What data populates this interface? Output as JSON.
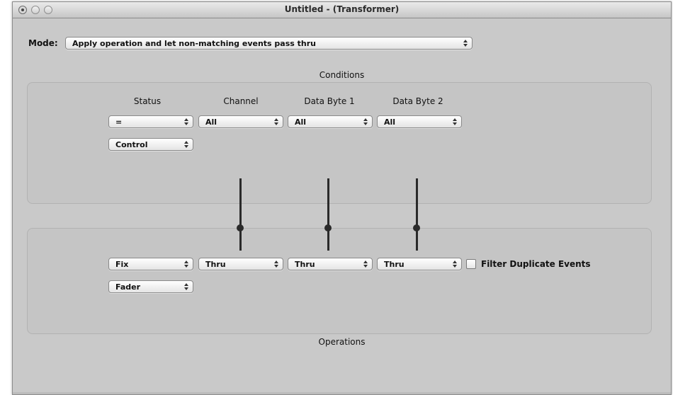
{
  "window": {
    "title": "Untitled - (Transformer)"
  },
  "mode": {
    "label": "Mode:",
    "value": "Apply operation and let non-matching events pass thru"
  },
  "conditions": {
    "heading": "Conditions",
    "columns": {
      "status": "Status",
      "channel": "Channel",
      "data_byte_1": "Data Byte 1",
      "data_byte_2": "Data Byte 2"
    },
    "status_operator": "=",
    "status_value": "Control",
    "channel_value": "All",
    "data_byte_1_value": "All",
    "data_byte_2_value": "All"
  },
  "operations": {
    "heading": "Operations",
    "status_operator": "Fix",
    "status_value": "Fader",
    "channel_value": "Thru",
    "data_byte_1_value": "Thru",
    "data_byte_2_value": "Thru",
    "filter_duplicates_label": "Filter Duplicate Events",
    "filter_duplicates_checked": false
  },
  "icons": [
    "close-icon",
    "minimize-icon",
    "zoom-icon",
    "popup-arrows-icon",
    "connector-icon"
  ]
}
